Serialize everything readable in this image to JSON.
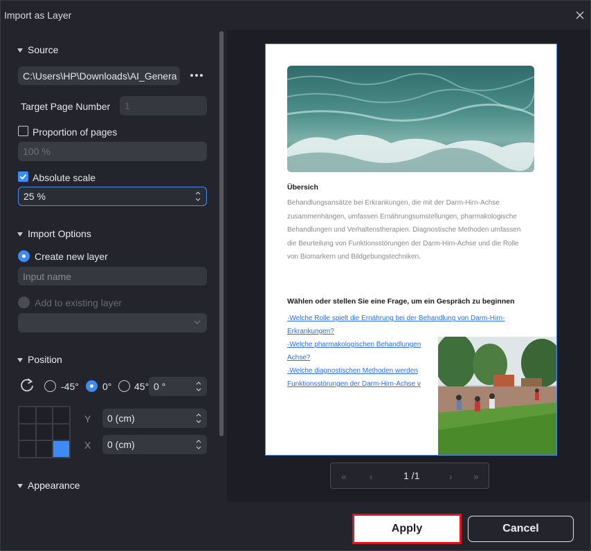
{
  "dialog": {
    "title": "Import as Layer"
  },
  "source": {
    "header": "Source",
    "path_value": "C:\\Users\\HP\\Downloads\\AI_Genera",
    "more_icon": "more-horizontal-icon",
    "target_page_label": "Target Page Number",
    "target_page_value": "1",
    "proportion_label": "Proportion of pages",
    "proportion_checked": false,
    "proportion_value": "100 %",
    "absolute_label": "Absolute scale",
    "absolute_checked": true,
    "absolute_value": "25 %"
  },
  "import_options": {
    "header": "Import Options",
    "create_new_label": "Create new layer",
    "input_name_placeholder": "Input name",
    "add_existing_label": "Add to existing layer"
  },
  "position": {
    "header": "Position",
    "rotate_icon": "rotate-icon",
    "angles": [
      "-45°",
      "0°",
      "45°"
    ],
    "selected_angle": "0°",
    "angle_value": "0 °",
    "y_label": "Y",
    "y_value": "0 (cm)",
    "x_label": "X",
    "x_value": "0 (cm)",
    "anchor_selected": "bottom-right"
  },
  "appearance": {
    "header": "Appearance"
  },
  "preview": {
    "heading": "Übersich",
    "paragraph": "Behandlungsansätze bei Erkrankungen, die mit der Darm-Hirn-Achse zusammenhängen, umfassen Ernährungsumstellungen, pharmakologische Behandlungen und Verhaltenstherapien. Diagnostische Methoden umfassen die Beurteilung von Funktionsstörungen der Darm-Hirn-Achse und die Rolle von Biomarkern und Bildgebungstechniken.",
    "question_heading": "Wählen oder stellen Sie eine Frage, um ein Gespräch zu beginnen",
    "links": [
      "·Welche Rolle spielt die Ernährung bei der Behandlung von Darm-Hirn-Erkrankungen?",
      "·Welche pharmakologischen Behandlungen",
      "Achse?",
      "·Welche diagnostischen Methoden werden",
      "Funktionsstörungen der Darm-Hirn-Achse v"
    ]
  },
  "pager": {
    "first": "«",
    "prev": "‹",
    "page_text": "1 /1",
    "next": "›",
    "last": "»"
  },
  "footer": {
    "apply": "Apply",
    "cancel": "Cancel"
  },
  "colors": {
    "accent": "#3d8bf5",
    "highlight": "#e0141e",
    "background": "#24252c"
  }
}
